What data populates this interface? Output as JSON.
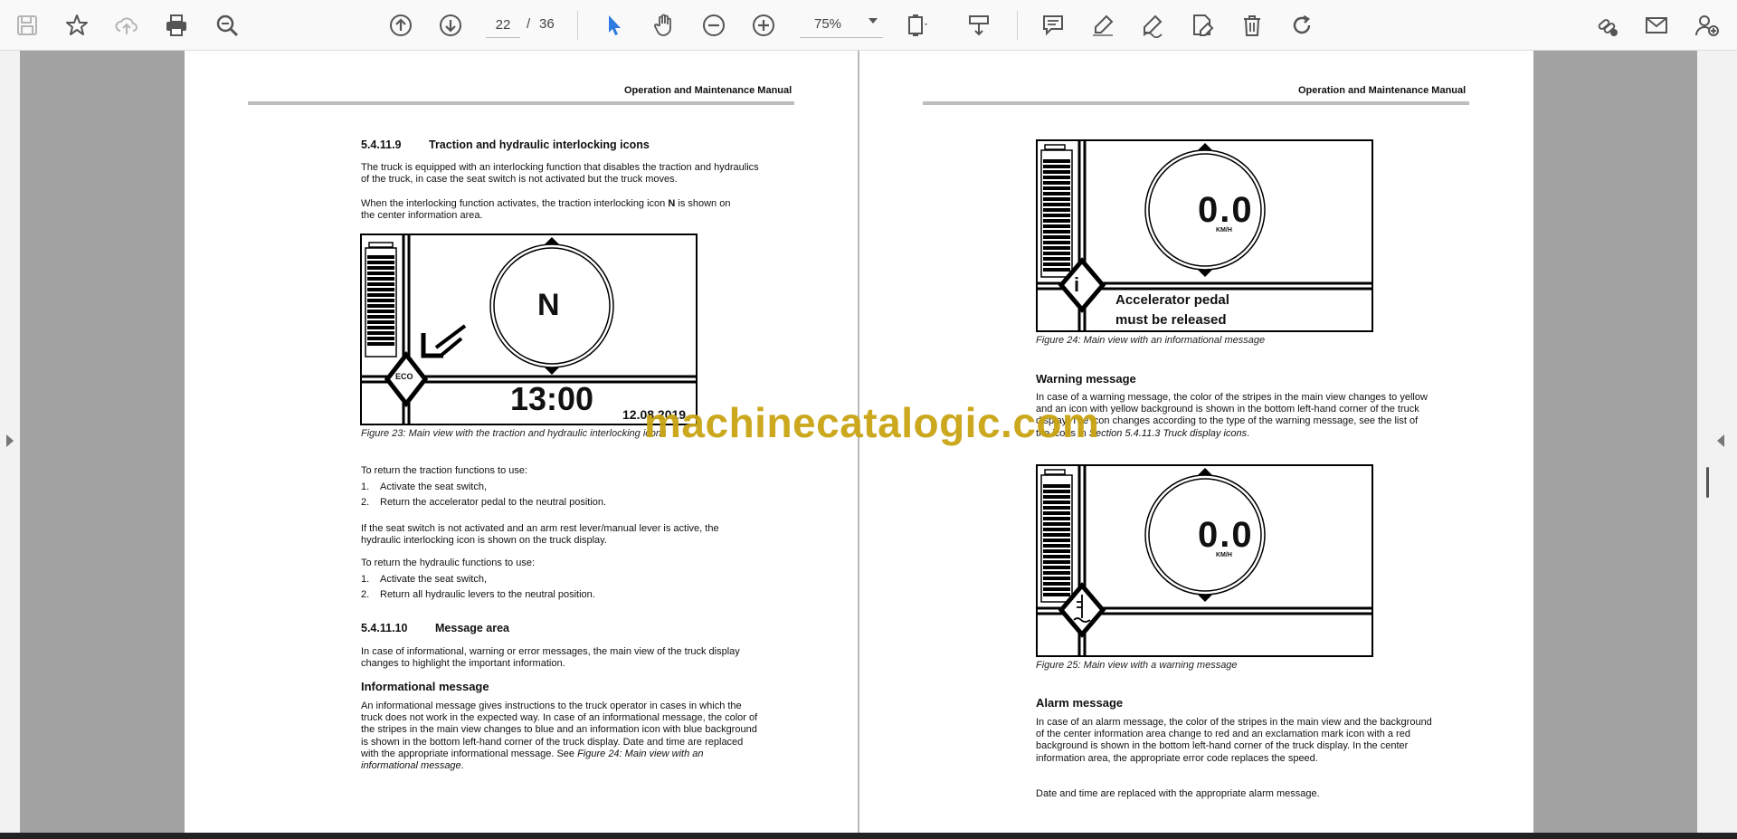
{
  "toolbar": {
    "page_current": "22",
    "page_sep": "/",
    "page_total": "36",
    "zoom": "75%"
  },
  "left_page": {
    "header": "Operation and Maintenance Manual",
    "s1_num": "5.4.11.9",
    "s1_title": "Traction and hydraulic interlocking icons",
    "p1": "The truck is equipped with an interlocking function that disables the traction and hydraulics of the truck, in case the seat switch is not activated but the truck moves.",
    "p2a": "When the interlocking function activates, the traction interlocking icon ",
    "p2b": "N",
    "p2c": " is shown on the center information area.",
    "fig23": {
      "icon": "N",
      "time": "13:00",
      "date": "12.08.2019",
      "eco": "ECO"
    },
    "fig23_caption": "Figure 23: Main view with the traction and hydraulic interlocking icons",
    "p3": "To return the traction functions to use:",
    "list1": [
      {
        "n": "1.",
        "t": "Activate the seat switch,"
      },
      {
        "n": "2.",
        "t": "Return the accelerator pedal to the neutral position."
      }
    ],
    "p4": "If the seat switch is not activated and an arm rest lever/manual lever is active, the hydraulic interlocking icon is shown on the truck display.",
    "p5": "To return the hydraulic functions to use:",
    "list2": [
      {
        "n": "1.",
        "t": "Activate the seat switch,"
      },
      {
        "n": "2.",
        "t": "Return all hydraulic levers to the neutral position."
      }
    ],
    "s2_num": "5.4.11.10",
    "s2_title": "Message area",
    "p6": "In case of informational, warning or error messages, the main view of the truck display changes to highlight the important information.",
    "h_info": "Informational message",
    "p7a": "An informational message gives instructions to the truck operator in cases in which the truck does not work in the expected way. In case of an informational message, the color of the stripes in the main view changes to blue and an information icon with blue background is shown in the bottom left-hand corner of the truck display. Date and time are replaced with the appropriate informational message. See ",
    "p7b": "Figure 24: Main view with an informational message",
    "p7c": "."
  },
  "right_page": {
    "header": "Operation and Maintenance Manual",
    "fig24": {
      "speed": "0.0",
      "unit": "KM/H",
      "msg1": "Accelerator pedal",
      "msg2": "must be released",
      "info": "i"
    },
    "fig24_caption": "Figure 24: Main view with an informational message",
    "h_warn": "Warning message",
    "p1a": "In case of a warning message, the color of the stripes in the main view changes to yellow and an icon with yellow background is shown in the bottom left-hand corner of the truck display. The icon changes according to the type of the warning message, see the list of the icons in ",
    "p1b": "Section 5.4.11.3 Truck display icons",
    "p1c": ".",
    "fig25": {
      "speed": "0.0",
      "unit": "KM/H"
    },
    "fig25_caption": "Figure 25: Main view with a warning message",
    "h_alarm": "Alarm message",
    "p2": "In case of an alarm message, the color of the stripes in the main view and the background of the center information area change to red and an exclamation mark icon with a red background is shown in the bottom left-hand corner of the truck display. In the center information area, the appropriate error code replaces the speed.",
    "p3": "Date and time are replaced with the appropriate alarm message."
  },
  "watermark": "machinecatalogic.com"
}
